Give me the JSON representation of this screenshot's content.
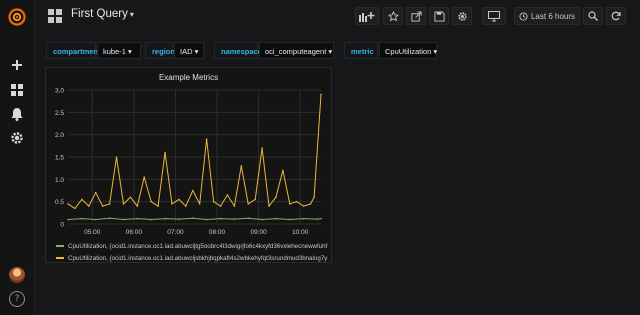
{
  "dashboard": {
    "title": "First Query"
  },
  "toolbar": {
    "time_range": "Last 6 hours"
  },
  "variables": [
    {
      "label": "compartment",
      "value": "kube-1"
    },
    {
      "label": "region",
      "value": "IAD"
    },
    {
      "label": "namespace",
      "value": "oci_computeagent"
    },
    {
      "label": "metric",
      "value": "CpuUtilization"
    }
  ],
  "panel": {
    "title": "Example Metrics"
  },
  "colors": {
    "series1": "#7eb26d",
    "series2": "#eab839",
    "accent": "#33b5e5"
  },
  "chart_data": {
    "type": "line",
    "title": "Example Metrics",
    "xlabel": "",
    "ylabel": "",
    "x_ticks": [
      "05:00",
      "06:00",
      "07:00",
      "08:00",
      "09:00",
      "10:00"
    ],
    "y_ticks": [
      "0",
      "0.5",
      "1.0",
      "1.5",
      "2.0",
      "2.5",
      "3.0"
    ],
    "ylim": [
      0,
      3.0
    ],
    "xlim": [
      "04:25",
      "10:30"
    ],
    "grid": true,
    "legend_position": "bottom",
    "series": [
      {
        "name": "CpuUtilization, {ocid1.instance.oc1.iad.abuwcljtg5oobrc4l3dwigrjfo6c4kxyfd36vxlehecnewwfuhf",
        "color": "#7eb26d",
        "x": [
          "04:25",
          "04:45",
          "05:05",
          "05:25",
          "05:45",
          "06:05",
          "06:25",
          "06:45",
          "07:05",
          "07:25",
          "07:45",
          "08:05",
          "08:25",
          "08:45",
          "09:05",
          "09:25",
          "09:45",
          "10:05",
          "10:25",
          "10:30"
        ],
        "values": [
          0.1,
          0.12,
          0.1,
          0.13,
          0.1,
          0.12,
          0.1,
          0.12,
          0.11,
          0.13,
          0.1,
          0.12,
          0.11,
          0.13,
          0.1,
          0.12,
          0.1,
          0.12,
          0.11,
          0.12
        ]
      },
      {
        "name": "CpuUtilization, {ocid1.instance.oc1.iad.abuwcljsbkhjbqpkaft4s2wbkehyfqt3srundmud3bnalog7y",
        "color": "#eab839",
        "x": [
          "04:25",
          "04:35",
          "04:45",
          "04:55",
          "05:05",
          "05:15",
          "05:25",
          "05:35",
          "05:45",
          "05:55",
          "06:05",
          "06:15",
          "06:25",
          "06:35",
          "06:45",
          "06:55",
          "07:05",
          "07:15",
          "07:25",
          "07:35",
          "07:45",
          "07:55",
          "08:05",
          "08:15",
          "08:25",
          "08:35",
          "08:45",
          "08:55",
          "09:05",
          "09:15",
          "09:25",
          "09:35",
          "09:45",
          "09:55",
          "10:05",
          "10:15",
          "10:20",
          "10:30"
        ],
        "values": [
          0.45,
          0.35,
          0.55,
          0.4,
          0.7,
          0.4,
          0.45,
          1.5,
          0.45,
          0.6,
          0.4,
          1.05,
          0.5,
          0.4,
          1.6,
          0.45,
          0.55,
          0.4,
          0.75,
          0.45,
          1.9,
          0.5,
          0.4,
          0.65,
          0.4,
          1.3,
          0.45,
          0.55,
          1.7,
          0.4,
          0.6,
          1.2,
          0.45,
          0.5,
          0.4,
          0.45,
          0.6,
          2.9
        ]
      }
    ]
  }
}
